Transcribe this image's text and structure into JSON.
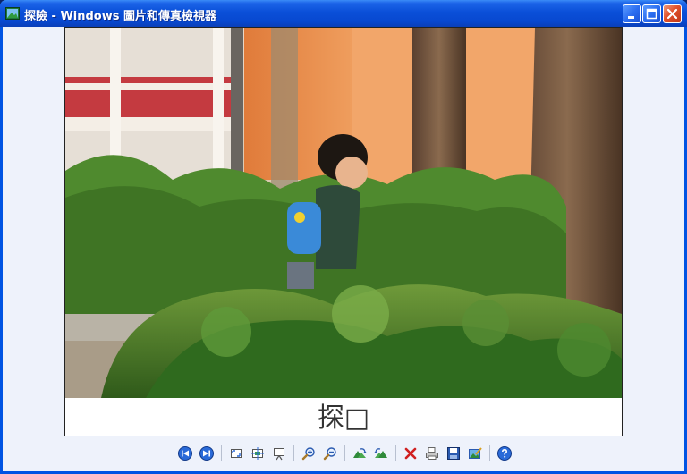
{
  "window": {
    "title": "探險 - Windows 圖片和傳真檢視器"
  },
  "viewer": {
    "caption": "探□"
  },
  "toolbar": {
    "buttons": [
      {
        "name": "previous-image-button",
        "icon": "previous-icon"
      },
      {
        "name": "next-image-button",
        "icon": "next-icon"
      },
      {
        "name": "best-fit-button",
        "icon": "best-fit-icon"
      },
      {
        "name": "actual-size-button",
        "icon": "actual-size-icon"
      },
      {
        "name": "slideshow-button",
        "icon": "slideshow-icon"
      },
      {
        "name": "zoom-in-button",
        "icon": "zoom-in-icon"
      },
      {
        "name": "zoom-out-button",
        "icon": "zoom-out-icon"
      },
      {
        "name": "rotate-clockwise-button",
        "icon": "rotate-clockwise-icon"
      },
      {
        "name": "rotate-counterclockwise-button",
        "icon": "rotate-counterclockwise-icon"
      },
      {
        "name": "delete-button",
        "icon": "delete-icon"
      },
      {
        "name": "print-button",
        "icon": "print-icon"
      },
      {
        "name": "save-button",
        "icon": "save-icon"
      },
      {
        "name": "open-for-editing-button",
        "icon": "edit-icon"
      },
      {
        "name": "help-button",
        "icon": "help-icon"
      }
    ]
  },
  "colors": {
    "titlebar": "#0a4fd8",
    "client_bg": "#eef2fb",
    "close_button": "#e0502a"
  }
}
